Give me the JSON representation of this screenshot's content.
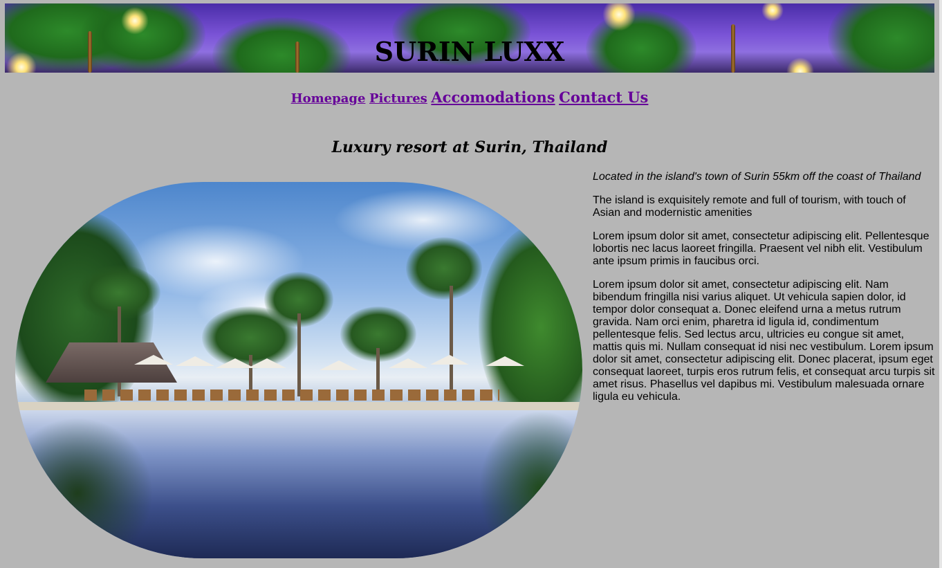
{
  "header": {
    "title": "SURIN LUXX"
  },
  "nav": {
    "items": [
      {
        "label": "Homepage"
      },
      {
        "label": "Pictures"
      },
      {
        "label": "Accomodations"
      },
      {
        "label": "Contact Us"
      }
    ]
  },
  "main": {
    "subtitle": "Luxury resort at Surin, Thailand",
    "hero_image": {
      "alt": "resort pool with palm trees and umbrellas",
      "icon": "resort-photo"
    },
    "paragraphs": [
      "Located in the island's town of Surin 55km off the coast of Thailand",
      "The island is exquisitely remote and full of tourism, with touch of Asian and modernistic amenities",
      "Lorem ipsum dolor sit amet, consectetur adipiscing elit. Pellentesque lobortis nec lacus laoreet fringilla. Praesent vel nibh elit. Vestibulum ante ipsum primis in faucibus orci.",
      "Lorem ipsum dolor sit amet, consectetur adipiscing elit. Nam bibendum fringilla nisi varius aliquet. Ut vehicula sapien dolor, id tempor dolor consequat a. Donec eleifend urna a metus rutrum gravida. Nam orci enim, pharetra id ligula id, condimentum pellentesque felis. Sed lectus arcu, ultricies eu congue sit amet, mattis quis mi. Nullam consequat id nisi nec vestibulum. Lorem ipsum dolor sit amet, consectetur adipiscing elit. Donec placerat, ipsum eget consequat laoreet, turpis eros rutrum felis, et consequat arcu turpis sit amet risus. Phasellus vel dapibus mi. Vestibulum malesuada ornare ligula eu vehicula."
    ]
  },
  "colors": {
    "background": "#b6b6b6",
    "link_visited": "#660099"
  }
}
